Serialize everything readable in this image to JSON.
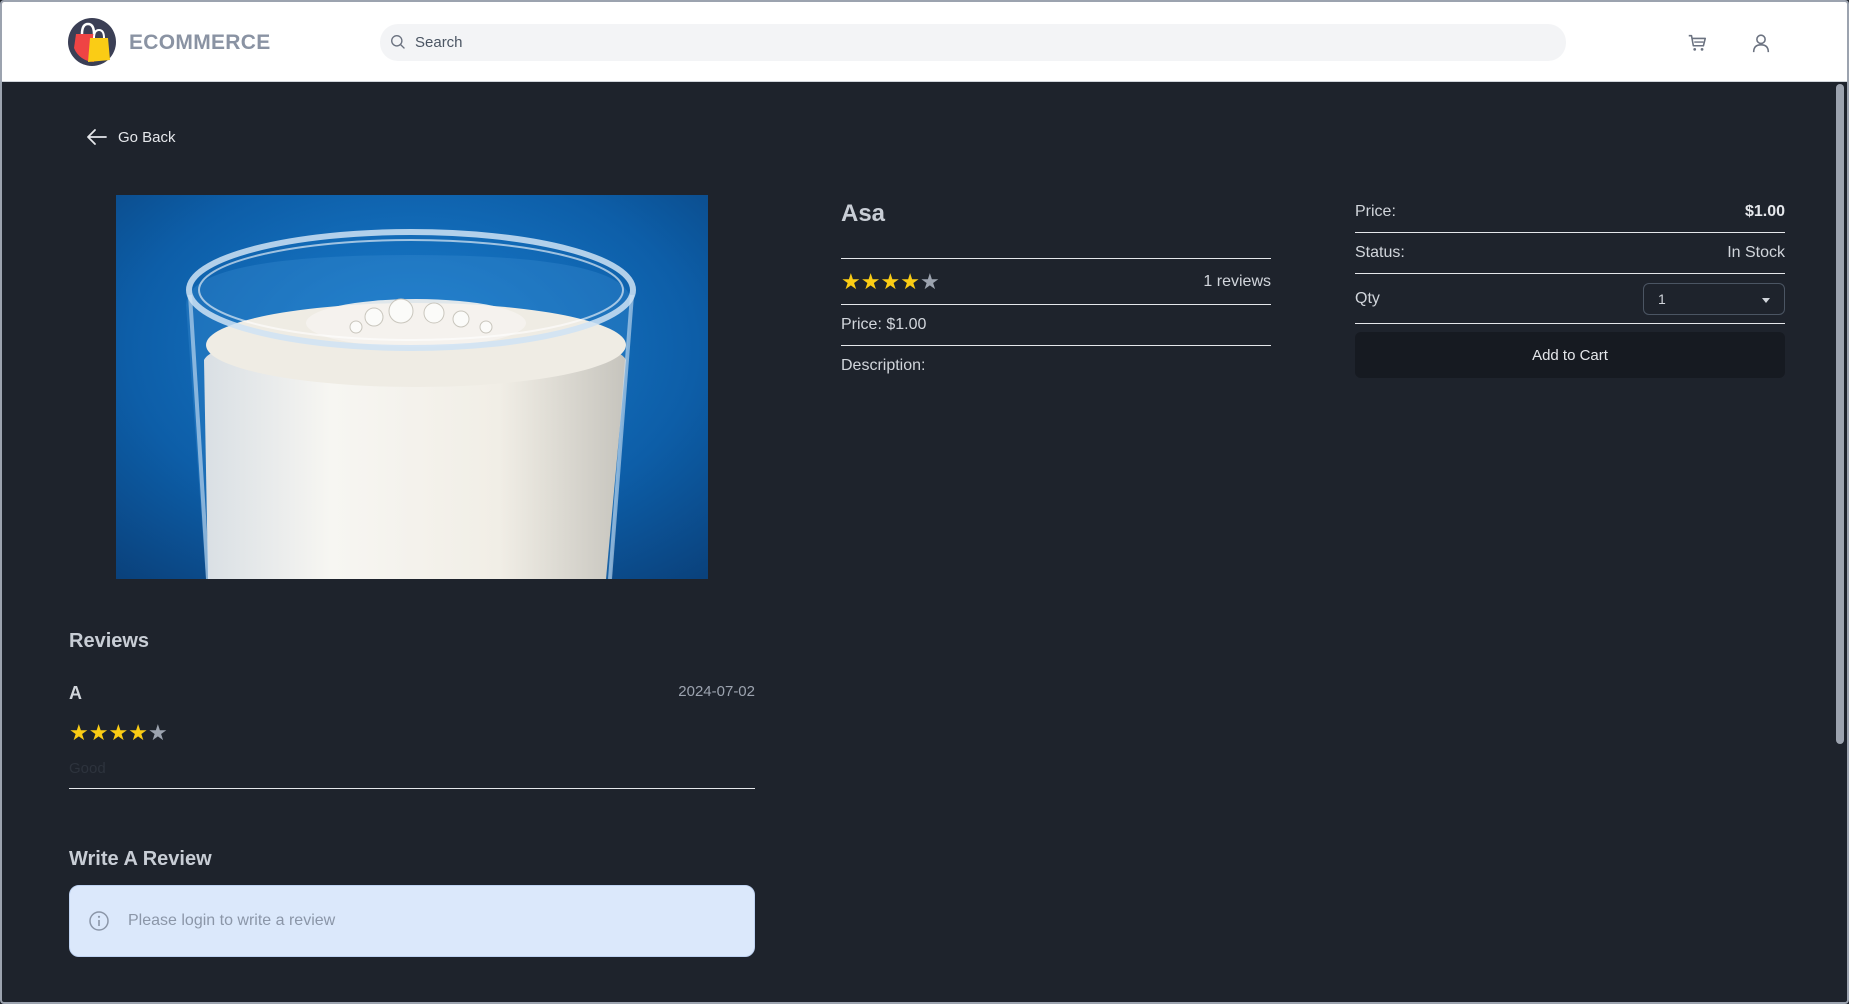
{
  "header": {
    "brand": "ECOMMERCE",
    "search_placeholder": "Search"
  },
  "nav": {
    "go_back": "Go Back"
  },
  "product": {
    "name": "Asa",
    "rating": 4,
    "rating_max": 5,
    "reviews_count": "1 reviews",
    "price_line": "Price: $1.00",
    "description_label": "Description:"
  },
  "purchase": {
    "price_label": "Price:",
    "price_value": "$1.00",
    "status_label": "Status:",
    "status_value": "In Stock",
    "qty_label": "Qty",
    "qty_value": "1",
    "add_to_cart": "Add to Cart"
  },
  "reviews": {
    "heading": "Reviews",
    "items": [
      {
        "name": "A",
        "date": "2024-07-02",
        "rating": 4,
        "comment": "Good"
      }
    ]
  },
  "write_review": {
    "heading": "Write A Review",
    "login_message": "Please login to write a review"
  },
  "colors": {
    "background": "#1e232c",
    "star_on": "#facc15",
    "star_off": "#9ca3af",
    "alert_bg": "#dbe8fb"
  }
}
